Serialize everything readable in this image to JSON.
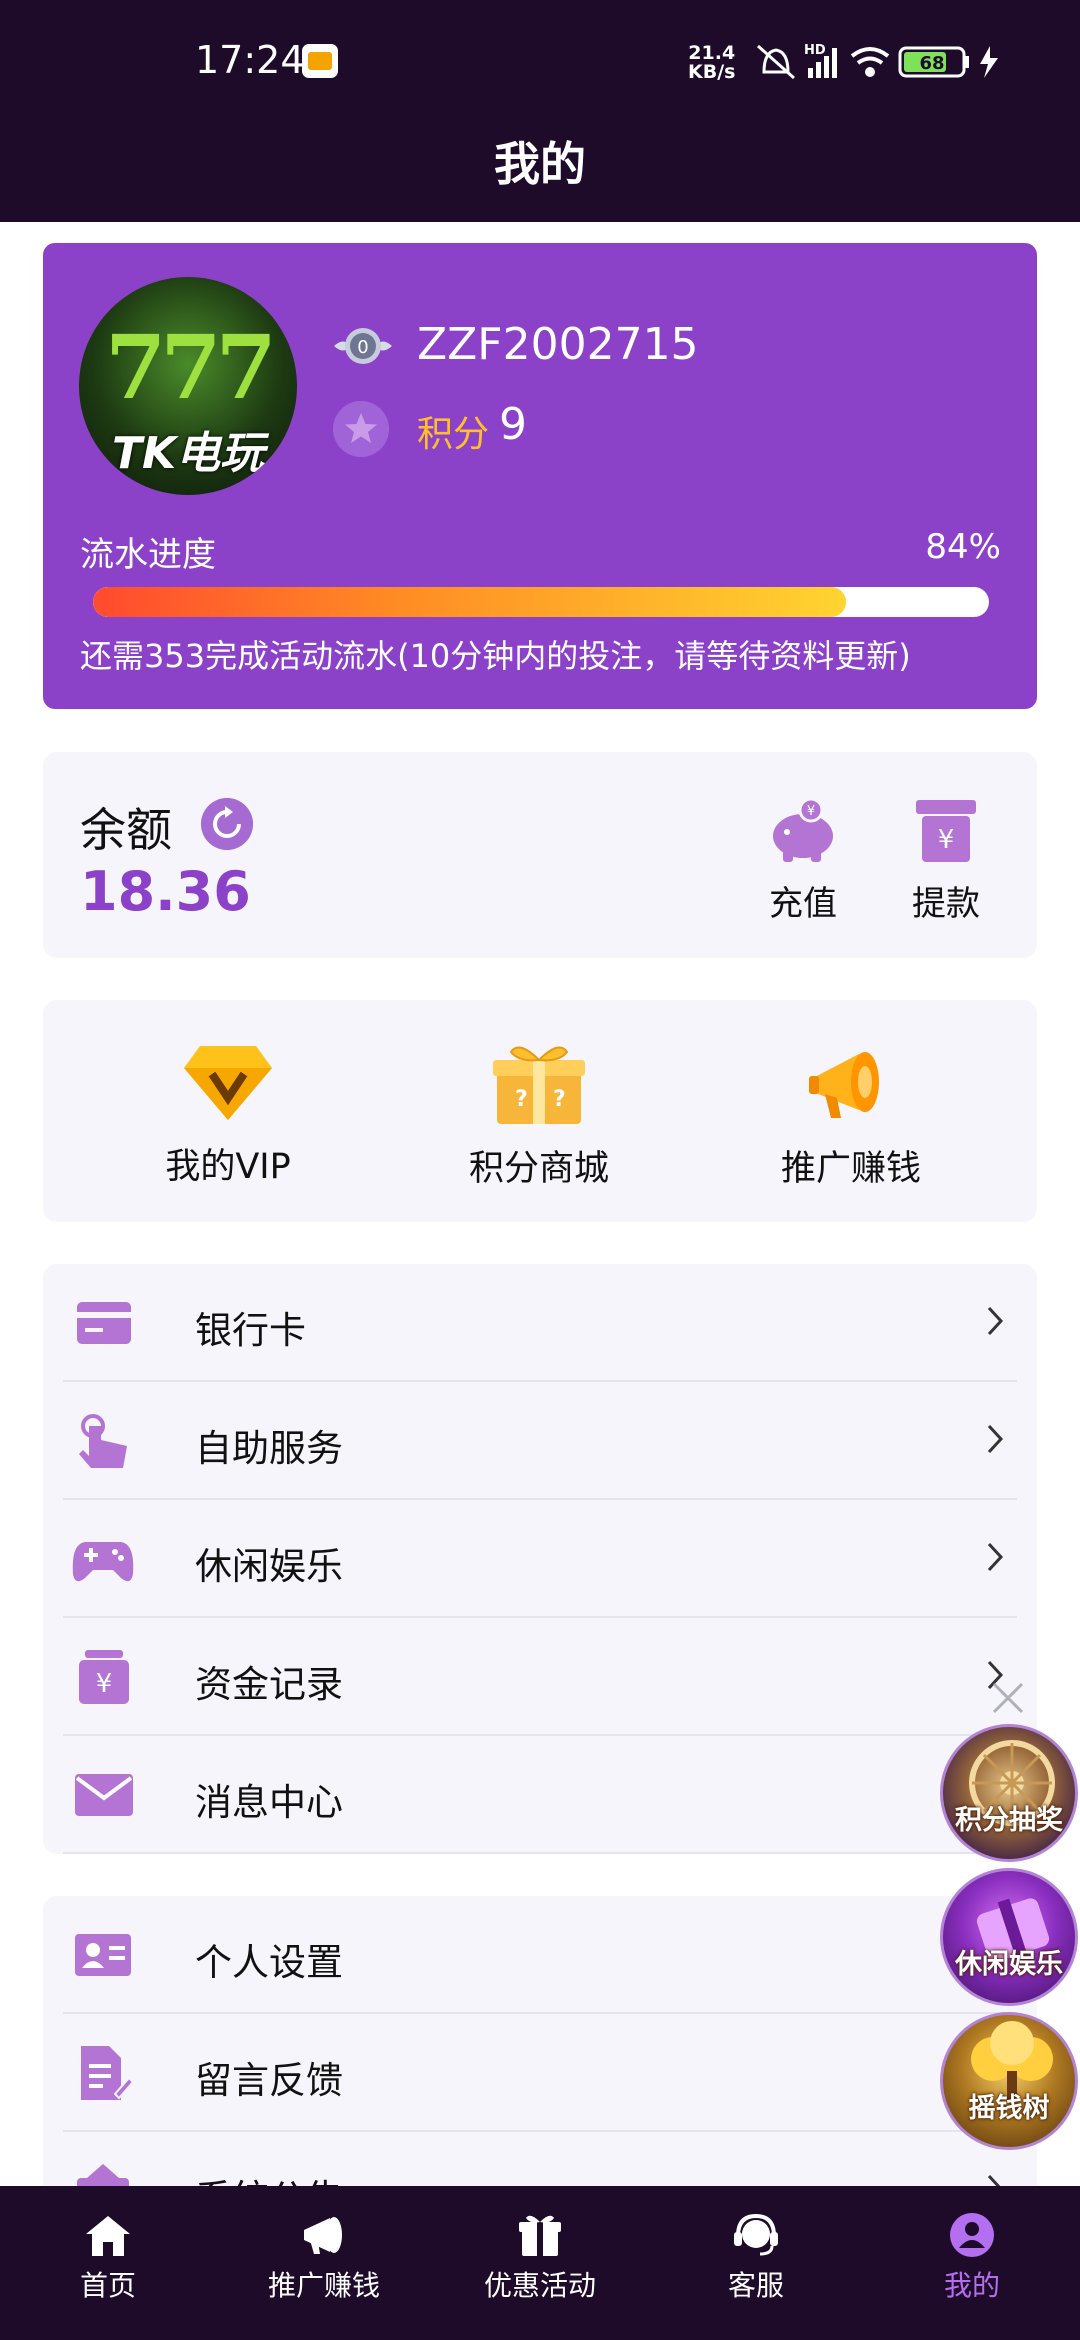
{
  "status_bar": {
    "time": "17:24",
    "net_speed_top": "21.4",
    "net_speed_bottom": "KB/s",
    "signal_tag": "HD",
    "battery": "68"
  },
  "header": {
    "title": "我的"
  },
  "profile": {
    "avatar_text": "TK电玩",
    "avatar_symbol": "777",
    "level": "0",
    "username": "ZZF2002715",
    "points_label": "积分",
    "points_value": "9",
    "progress_label": "流水进度",
    "progress_percent_text": "84%",
    "progress_fraction": 0.84,
    "progress_note": "还需353完成活动流水(10分钟内的投注，请等待资料更新)"
  },
  "balance": {
    "label": "余额",
    "value": "18.36",
    "recharge_label": "充值",
    "withdraw_label": "提款"
  },
  "features": [
    {
      "label": "我的VIP",
      "icon": "vip-diamond-icon"
    },
    {
      "label": "积分商城",
      "icon": "gift-box-icon"
    },
    {
      "label": "推广赚钱",
      "icon": "megaphone-icon"
    }
  ],
  "menu_group_1": [
    {
      "label": "银行卡",
      "icon": "bank-card-icon"
    },
    {
      "label": "自助服务",
      "icon": "hand-tap-icon"
    },
    {
      "label": "休闲娱乐",
      "icon": "gamepad-icon"
    },
    {
      "label": "资金记录",
      "icon": "yen-box-icon"
    },
    {
      "label": "消息中心",
      "icon": "mail-icon"
    }
  ],
  "menu_group_2": [
    {
      "label": "个人设置",
      "icon": "id-card-icon"
    },
    {
      "label": "留言反馈",
      "icon": "edit-doc-icon"
    },
    {
      "label": "系统公告",
      "icon": "notice-board-icon"
    }
  ],
  "floating": [
    {
      "label": "积分抽奖"
    },
    {
      "label": "休闲娱乐"
    },
    {
      "label": "摇钱树"
    }
  ],
  "nav": [
    {
      "label": "首页",
      "icon": "home-icon"
    },
    {
      "label": "推广赚钱",
      "icon": "megaphone-icon"
    },
    {
      "label": "优惠活动",
      "icon": "gift-icon"
    },
    {
      "label": "客服",
      "icon": "headset-icon"
    },
    {
      "label": "我的",
      "icon": "user-icon",
      "active": true
    }
  ],
  "colors": {
    "accent": "#8b42c9",
    "dark": "#1e0b2a",
    "points": "#ffbe2e",
    "icon": "#b374d4"
  }
}
